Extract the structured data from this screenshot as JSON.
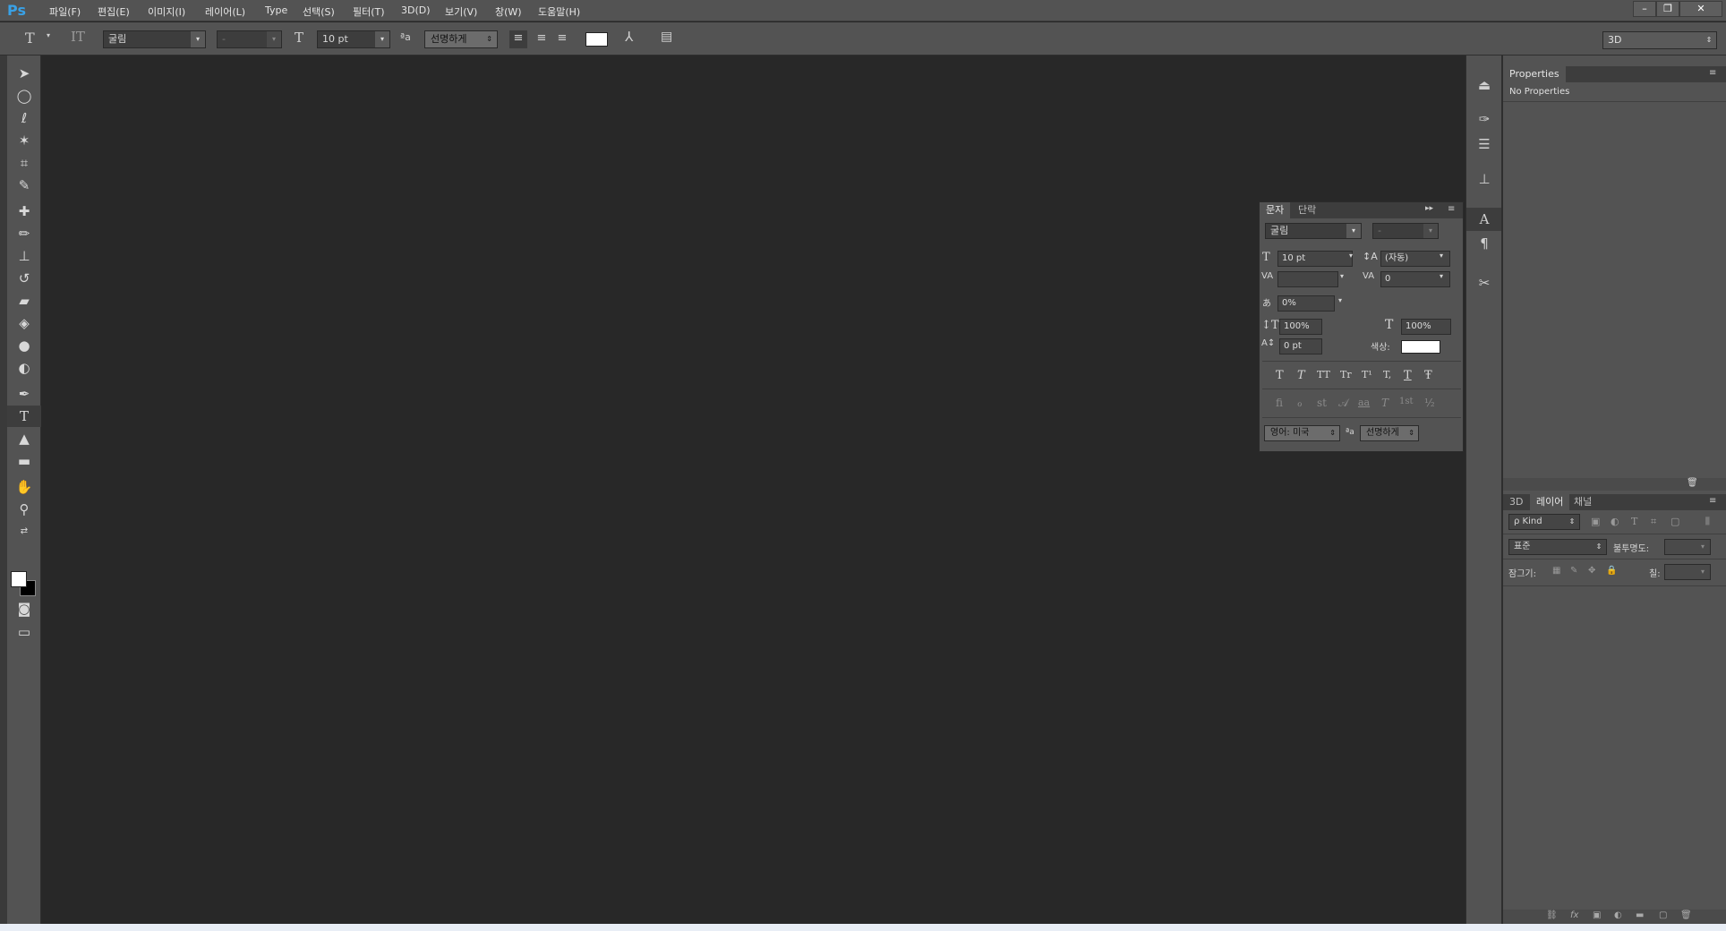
{
  "app": {
    "logo": "Ps"
  },
  "menu": [
    "파일(F)",
    "편집(E)",
    "이미지(I)",
    "레이어(L)",
    "Type",
    "선택(S)",
    "필터(T)",
    "3D(D)",
    "보기(V)",
    "창(W)",
    "도움말(H)"
  ],
  "window_controls": {
    "minimize": "–",
    "restore": "❐",
    "close": "✕"
  },
  "options": {
    "font_family": "굴림",
    "font_style": "-",
    "font_size": "10 pt",
    "anti_alias_icon": "ªa",
    "anti_alias": "선명하게",
    "workspace": "3D",
    "text_color": "#ffffff"
  },
  "properties_panel": {
    "tab": "Properties",
    "content": "No Properties"
  },
  "character_panel": {
    "tabs": [
      "문자",
      "단락"
    ],
    "font_family": "굴림",
    "font_style": "-",
    "font_size": "10 pt",
    "leading": "(자동)",
    "kerning": "",
    "tracking": "0",
    "tsume": "0%",
    "vertical_scale": "100%",
    "horizontal_scale": "100%",
    "baseline_shift": "0 pt",
    "color_label": "색상:",
    "text_color": "#ffffff",
    "style_buttons": [
      "T",
      "T",
      "TT",
      "Tr",
      "T¹",
      "T,",
      "T",
      "Ŧ"
    ],
    "opentype_buttons": [
      "fi",
      "ℴ",
      "st",
      "𝒜",
      "aa",
      "T",
      "1st",
      "½"
    ],
    "language": "영어: 미국",
    "anti_alias_icon": "ªa",
    "anti_alias": "선명하게"
  },
  "layers_panel": {
    "tabs": [
      "3D",
      "레이어",
      "채널"
    ],
    "active_tab": "레이어",
    "filter_kind": "ρ Kind",
    "blend_mode": "표준",
    "opacity_label": "불투명도:",
    "opacity_value": "",
    "lock_label": "잠그기:",
    "fill_label": "칠:",
    "fill_value": ""
  }
}
